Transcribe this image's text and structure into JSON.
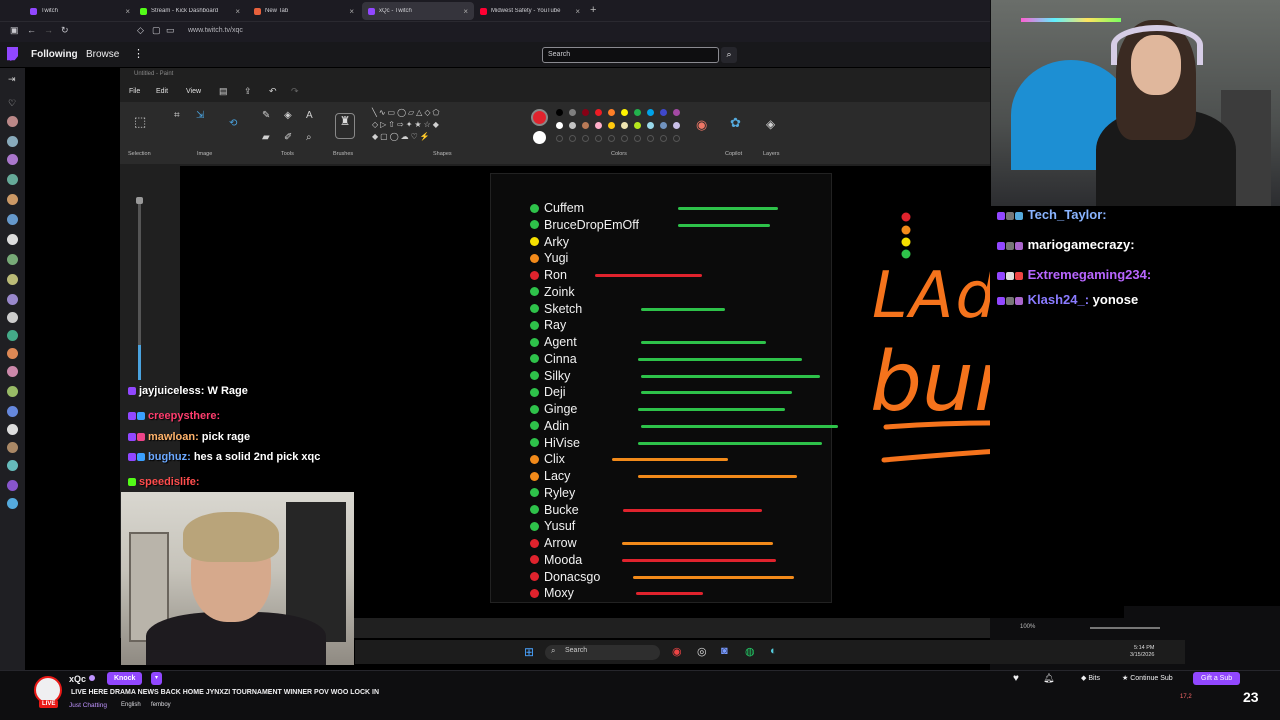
{
  "browser": {
    "tabs": [
      {
        "label": "Twitch",
        "color": "#9147ff"
      },
      {
        "label": "Stream - Kick Dashboard",
        "color": "#53fc18"
      },
      {
        "label": "New Tab",
        "color": "#e8613c"
      },
      {
        "label": "xQc - Twitch",
        "color": "#9147ff"
      },
      {
        "label": "Midwest Safety - YouTube",
        "color": "#ff0033"
      }
    ],
    "url": "www.twitch.tv/xqc"
  },
  "topnav": {
    "following": "Following",
    "browse": "Browse",
    "search_placeholder": "Search"
  },
  "paint": {
    "title": "Untitled - Paint",
    "menus": [
      "File",
      "Edit",
      "View"
    ],
    "groups": [
      "Selection",
      "Image",
      "Tools",
      "Brushes",
      "Shapes",
      "Colors",
      "Copilot",
      "Layers"
    ],
    "zoom": "100%"
  },
  "tier_list": [
    {
      "name": "Cuffem",
      "dot": "#2ec24a",
      "stroke": "#2ec24a"
    },
    {
      "name": "BruceDropEmOff",
      "dot": "#2ec24a",
      "stroke": "#2ec24a"
    },
    {
      "name": "Arky",
      "dot": "#f5e000",
      "stroke": ""
    },
    {
      "name": "Yugi",
      "dot": "#f28a1a",
      "stroke": ""
    },
    {
      "name": "Ron",
      "dot": "#e0232d",
      "stroke": "#e0232d"
    },
    {
      "name": "Zoink",
      "dot": "#2ec24a",
      "stroke": ""
    },
    {
      "name": "Sketch",
      "dot": "#2ec24a",
      "stroke": "#2ec24a"
    },
    {
      "name": "Ray",
      "dot": "#2ec24a",
      "stroke": ""
    },
    {
      "name": "Agent",
      "dot": "#2ec24a",
      "stroke": "#2ec24a"
    },
    {
      "name": "Cinna",
      "dot": "#2ec24a",
      "stroke": "#2ec24a"
    },
    {
      "name": "Silky",
      "dot": "#2ec24a",
      "stroke": "#2ec24a"
    },
    {
      "name": "Deji",
      "dot": "#2ec24a",
      "stroke": "#2ec24a"
    },
    {
      "name": "Ginge",
      "dot": "#2ec24a",
      "stroke": "#2ec24a"
    },
    {
      "name": "Adin",
      "dot": "#2ec24a",
      "stroke": "#2ec24a"
    },
    {
      "name": "HiVise",
      "dot": "#2ec24a",
      "stroke": "#2ec24a"
    },
    {
      "name": "Clix",
      "dot": "#f28a1a",
      "stroke": "#f28a1a"
    },
    {
      "name": "Lacy",
      "dot": "#f28a1a",
      "stroke": "#f28a1a"
    },
    {
      "name": "Ryley",
      "dot": "#2ec24a",
      "stroke": ""
    },
    {
      "name": "Bucke",
      "dot": "#2ec24a",
      "stroke": "#e0232d"
    },
    {
      "name": "Yusuf",
      "dot": "#2ec24a",
      "stroke": ""
    },
    {
      "name": "Arrow",
      "dot": "#e0232d",
      "stroke": "#f28a1a"
    },
    {
      "name": "Mooda",
      "dot": "#e0232d",
      "stroke": "#e0232d"
    },
    {
      "name": "Donacsgo",
      "dot": "#e0232d",
      "stroke": "#f28a1a"
    },
    {
      "name": "Moxy",
      "dot": "#e0232d",
      "stroke": "#e0232d"
    }
  ],
  "handwriting": {
    "line1": "LAdy",
    "line2": "buns",
    "color": "#f5731c"
  },
  "left_chat": [
    {
      "user": "jayjuiceless:",
      "msg": "W Rage",
      "color": "#ffffff"
    },
    {
      "user": "creepysthere:",
      "msg": "",
      "color": "#ff3d6e"
    },
    {
      "user": "mawloan:",
      "msg": "pick rage",
      "color": "#ffb36b"
    },
    {
      "user": "bughuz:",
      "msg": "hes a solid 2nd pick xqc",
      "color": "#6ba8ff"
    },
    {
      "user": "speedislife:",
      "msg": "",
      "color": "#ff4d4d"
    }
  ],
  "right_chat": [
    {
      "user": "Tech_Taylor:",
      "msg": "",
      "color": "#8ab4ff"
    },
    {
      "user": "mariogamecrazy:",
      "msg": "",
      "color": "#ffffff"
    },
    {
      "user": "Extremegaming234:",
      "msg": "",
      "color": "#b866ff"
    },
    {
      "user": "Klash24_:",
      "msg": "yonose",
      "color": "#8a7bff"
    }
  ],
  "taskbar": {
    "search": "Search",
    "time": "5:14 PM",
    "date": "3/15/2026"
  },
  "channel": {
    "name": "xQc",
    "live": "LIVE",
    "knock": "Knock",
    "title": "LIVE HERE DRAMA NEWS BACK HOME JYNXZI TOURNAMENT WINNER POV WOO LOCK IN",
    "category": "Just Chatting",
    "tags": [
      "English",
      "femboy"
    ],
    "bits": "Bits",
    "continue_sub": "Continue Sub",
    "gift": "Gift a Sub",
    "viewers": "17,2",
    "watermark": "23"
  }
}
